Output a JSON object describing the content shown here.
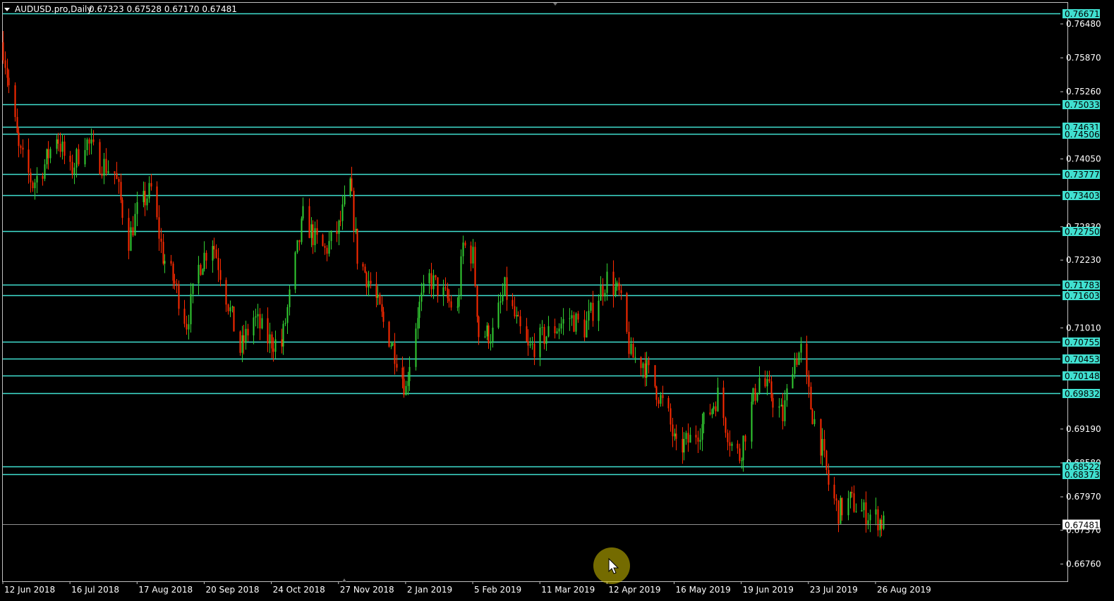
{
  "header": {
    "symbol_timeframe": "AUDUSD.pro,Daily",
    "ohlc": "0.67323 0.67528 0.67170 0.67481"
  },
  "colors": {
    "background": "#000000",
    "frame": "#c0c0c0",
    "bull": "#32cd32",
    "bear": "#ff2a00",
    "level_line": "#40e0d0",
    "level_label_bg": "#40e0d0",
    "current_price_line": "#909090",
    "cursor_highlight": "#d4c200"
  },
  "chart_data": {
    "type": "candlestick",
    "symbol": "AUDUSD.pro",
    "timeframe": "Daily",
    "ylim": [
      0.6645,
      0.7686
    ],
    "grid": false,
    "price_axis_ticks": [
      "0.76480",
      "0.75870",
      "0.75260",
      "0.74050",
      "0.72830",
      "0.72230",
      "0.71010",
      "0.69190",
      "0.68580",
      "0.67970",
      "0.67370",
      "0.66760"
    ],
    "time_axis_ticks": [
      {
        "label": "12 Jun 2018",
        "date": "2018-06-12"
      },
      {
        "label": "16 Jul 2018",
        "date": "2018-07-16"
      },
      {
        "label": "17 Aug 2018",
        "date": "2018-08-17"
      },
      {
        "label": "20 Sep 2018",
        "date": "2018-09-20"
      },
      {
        "label": "24 Oct 2018",
        "date": "2018-10-24"
      },
      {
        "label": "27 Nov 2018",
        "date": "2018-11-27"
      },
      {
        "label": "2 Jan 2019",
        "date": "2019-01-02"
      },
      {
        "label": "5 Feb 2019",
        "date": "2019-02-05"
      },
      {
        "label": "11 Mar 2019",
        "date": "2019-03-11"
      },
      {
        "label": "12 Apr 2019",
        "date": "2019-04-12"
      },
      {
        "label": "16 May 2019",
        "date": "2019-05-16"
      },
      {
        "label": "19 Jun 2019",
        "date": "2019-06-19"
      },
      {
        "label": "23 Jul 2019",
        "date": "2019-07-23"
      },
      {
        "label": "26 Aug 2019",
        "date": "2019-08-26"
      }
    ],
    "horizontal_levels": [
      "0.76671",
      "0.75033",
      "0.74631",
      "0.74506",
      "0.73777",
      "0.73403",
      "0.72750",
      "0.71783",
      "0.71603",
      "0.70755",
      "0.70453",
      "0.70148",
      "0.69832",
      "0.68522",
      "0.68373"
    ],
    "current_price": "0.67481",
    "price_path": [
      {
        "date": "2018-06-12",
        "close": 0.7605
      },
      {
        "date": "2018-06-20",
        "close": 0.742
      },
      {
        "date": "2018-06-27",
        "close": 0.736
      },
      {
        "date": "2018-07-03",
        "close": 0.7395
      },
      {
        "date": "2018-07-09",
        "close": 0.745
      },
      {
        "date": "2018-07-16",
        "close": 0.738
      },
      {
        "date": "2018-07-23",
        "close": 0.744
      },
      {
        "date": "2018-07-30",
        "close": 0.74
      },
      {
        "date": "2018-08-06",
        "close": 0.738
      },
      {
        "date": "2018-08-13",
        "close": 0.726
      },
      {
        "date": "2018-08-17",
        "close": 0.731
      },
      {
        "date": "2018-08-24",
        "close": 0.735
      },
      {
        "date": "2018-08-30",
        "close": 0.723
      },
      {
        "date": "2018-09-05",
        "close": 0.718
      },
      {
        "date": "2018-09-11",
        "close": 0.711
      },
      {
        "date": "2018-09-17",
        "close": 0.721
      },
      {
        "date": "2018-09-24",
        "close": 0.726
      },
      {
        "date": "2018-10-01",
        "close": 0.716
      },
      {
        "date": "2018-10-08",
        "close": 0.706
      },
      {
        "date": "2018-10-15",
        "close": 0.712
      },
      {
        "date": "2018-10-22",
        "close": 0.708
      },
      {
        "date": "2018-10-29",
        "close": 0.707
      },
      {
        "date": "2018-11-05",
        "close": 0.722
      },
      {
        "date": "2018-11-09",
        "close": 0.73
      },
      {
        "date": "2018-11-15",
        "close": 0.726
      },
      {
        "date": "2018-11-20",
        "close": 0.724
      },
      {
        "date": "2018-11-27",
        "close": 0.728
      },
      {
        "date": "2018-12-03",
        "close": 0.736
      },
      {
        "date": "2018-12-07",
        "close": 0.723
      },
      {
        "date": "2018-12-14",
        "close": 0.718
      },
      {
        "date": "2018-12-21",
        "close": 0.711
      },
      {
        "date": "2018-12-28",
        "close": 0.705
      },
      {
        "date": "2019-01-02",
        "close": 0.699
      },
      {
        "date": "2019-01-03",
        "close": 0.702
      },
      {
        "date": "2019-01-08",
        "close": 0.713
      },
      {
        "date": "2019-01-14",
        "close": 0.719
      },
      {
        "date": "2019-01-21",
        "close": 0.716
      },
      {
        "date": "2019-01-28",
        "close": 0.713
      },
      {
        "date": "2019-01-31",
        "close": 0.725
      },
      {
        "date": "2019-02-05",
        "close": 0.723
      },
      {
        "date": "2019-02-08",
        "close": 0.709
      },
      {
        "date": "2019-02-15",
        "close": 0.709
      },
      {
        "date": "2019-02-21",
        "close": 0.717
      },
      {
        "date": "2019-02-27",
        "close": 0.711
      },
      {
        "date": "2019-03-05",
        "close": 0.706
      },
      {
        "date": "2019-03-11",
        "close": 0.708
      },
      {
        "date": "2019-03-18",
        "close": 0.71
      },
      {
        "date": "2019-03-25",
        "close": 0.712
      },
      {
        "date": "2019-04-01",
        "close": 0.71
      },
      {
        "date": "2019-04-08",
        "close": 0.716
      },
      {
        "date": "2019-04-12",
        "close": 0.719
      },
      {
        "date": "2019-04-18",
        "close": 0.716
      },
      {
        "date": "2019-04-24",
        "close": 0.705
      },
      {
        "date": "2019-04-30",
        "close": 0.704
      },
      {
        "date": "2019-05-07",
        "close": 0.699
      },
      {
        "date": "2019-05-13",
        "close": 0.694
      },
      {
        "date": "2019-05-17",
        "close": 0.688
      },
      {
        "date": "2019-05-24",
        "close": 0.69
      },
      {
        "date": "2019-05-31",
        "close": 0.693
      },
      {
        "date": "2019-06-07",
        "close": 0.698
      },
      {
        "date": "2019-06-14",
        "close": 0.689
      },
      {
        "date": "2019-06-18",
        "close": 0.687
      },
      {
        "date": "2019-06-24",
        "close": 0.696
      },
      {
        "date": "2019-06-28",
        "close": 0.701
      },
      {
        "date": "2019-07-04",
        "close": 0.698
      },
      {
        "date": "2019-07-10",
        "close": 0.694
      },
      {
        "date": "2019-07-15",
        "close": 0.704
      },
      {
        "date": "2019-07-19",
        "close": 0.706
      },
      {
        "date": "2019-07-24",
        "close": 0.696
      },
      {
        "date": "2019-07-30",
        "close": 0.688
      },
      {
        "date": "2019-08-02",
        "close": 0.682
      },
      {
        "date": "2019-08-07",
        "close": 0.677
      },
      {
        "date": "2019-08-13",
        "close": 0.679
      },
      {
        "date": "2019-08-19",
        "close": 0.677
      },
      {
        "date": "2019-08-26",
        "close": 0.676
      },
      {
        "date": "2019-08-30",
        "close": 0.6748
      }
    ]
  }
}
